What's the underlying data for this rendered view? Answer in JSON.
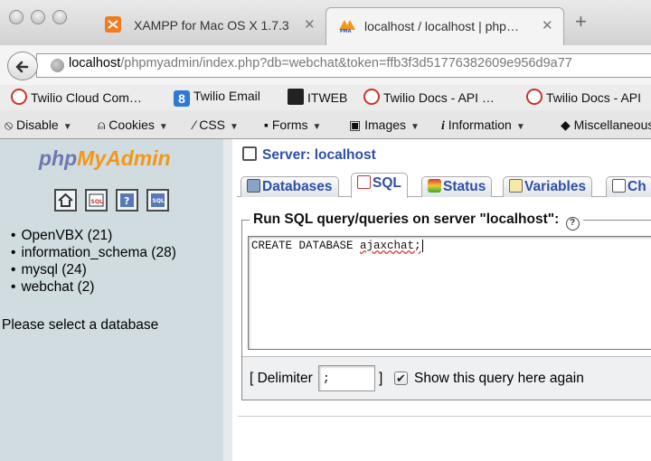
{
  "browser": {
    "tabs": [
      {
        "title": "XAMPP for Mac OS X 1.7.3",
        "active": false
      },
      {
        "title": "localhost / localhost | php…",
        "active": true
      }
    ],
    "url_host": "localhost",
    "url_rest": "/phpmyadmin/index.php?db=webchat&token=ffb3f3d51776382609e956d9a77",
    "bookmarks": [
      "Twilio Cloud Com…",
      "Twilio Email",
      "ITWEB",
      "Twilio Docs - API …",
      "Twilio Docs - API"
    ],
    "devtools": [
      "Disable",
      "Cookies",
      "CSS",
      "Forms",
      "Images",
      "Information",
      "Miscellaneous"
    ]
  },
  "pma": {
    "logo_php": "php",
    "logo_myadmin": "MyAdmin",
    "databases": [
      "OpenVBX (21)",
      "information_schema (28)",
      "mysql (24)",
      "webchat (2)"
    ],
    "select_prompt": "Please select a database",
    "server_title": "Server: localhost",
    "tabs": [
      "Databases",
      "SQL",
      "Status",
      "Variables",
      "Ch"
    ],
    "active_tab": "SQL",
    "legend": "Run SQL query/queries on server \"localhost\":",
    "sql_prefix": "CREATE DATABASE ",
    "sql_word": "ajaxchat;",
    "delimiter_label": "[ Delimiter",
    "delimiter_value": ";",
    "delimiter_close": "]",
    "show_query_label": "Show this query here again",
    "show_query_checked": true
  },
  "colors": {
    "link": "#2f4fa8",
    "nav_bg": "#d0dce0",
    "logo_orange": "#f29718",
    "logo_blue": "#6c78af"
  }
}
